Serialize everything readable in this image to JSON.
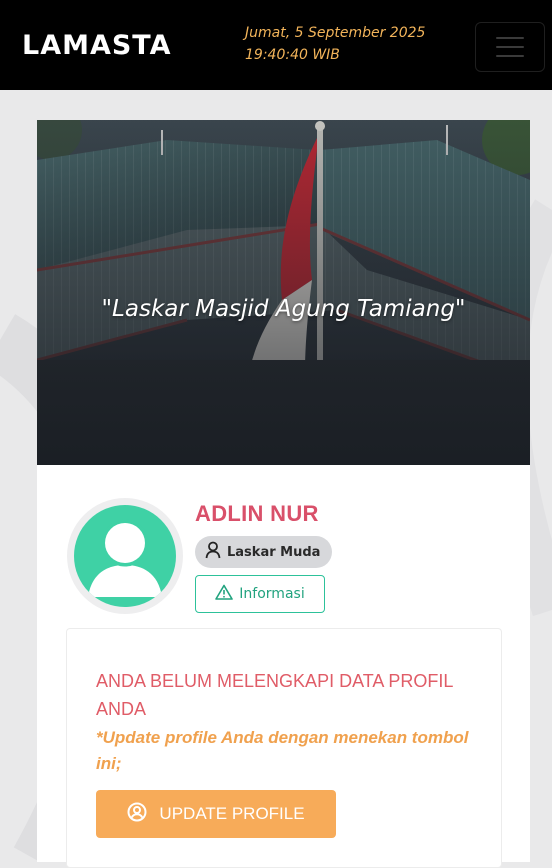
{
  "navbar": {
    "brand": "LAMASTA",
    "date": "Jumat, 5 September 2025",
    "time": "19:40:40 WIB",
    "menu_icon": "hamburger-icon"
  },
  "hero": {
    "quote": "\"Laskar Masjid Agung Tamiang\""
  },
  "profile": {
    "name": "ADLIN NUR",
    "role": "Laskar Muda",
    "role_icon": "user-icon",
    "info_button": "Informasi",
    "info_icon": "warning-triangle-icon",
    "avatar_icon": "user-avatar-icon"
  },
  "alert": {
    "title": "ANDA BELUM MELENGKAPI DATA PROFIL ANDA",
    "note": "*Update profile Anda dengan menekan tombol ini;",
    "button": "UPDATE PROFILE",
    "button_icon": "user-circle-icon"
  },
  "colors": {
    "navbar_bg": "#000000",
    "date_color": "#f2b45a",
    "name_color": "#d9506a",
    "avatar_color": "#3fd1a5",
    "info_border": "#2dc29a",
    "alert_title": "#e05c67",
    "alert_note": "#f0a14e",
    "update_button_bg": "#f7ab59"
  }
}
